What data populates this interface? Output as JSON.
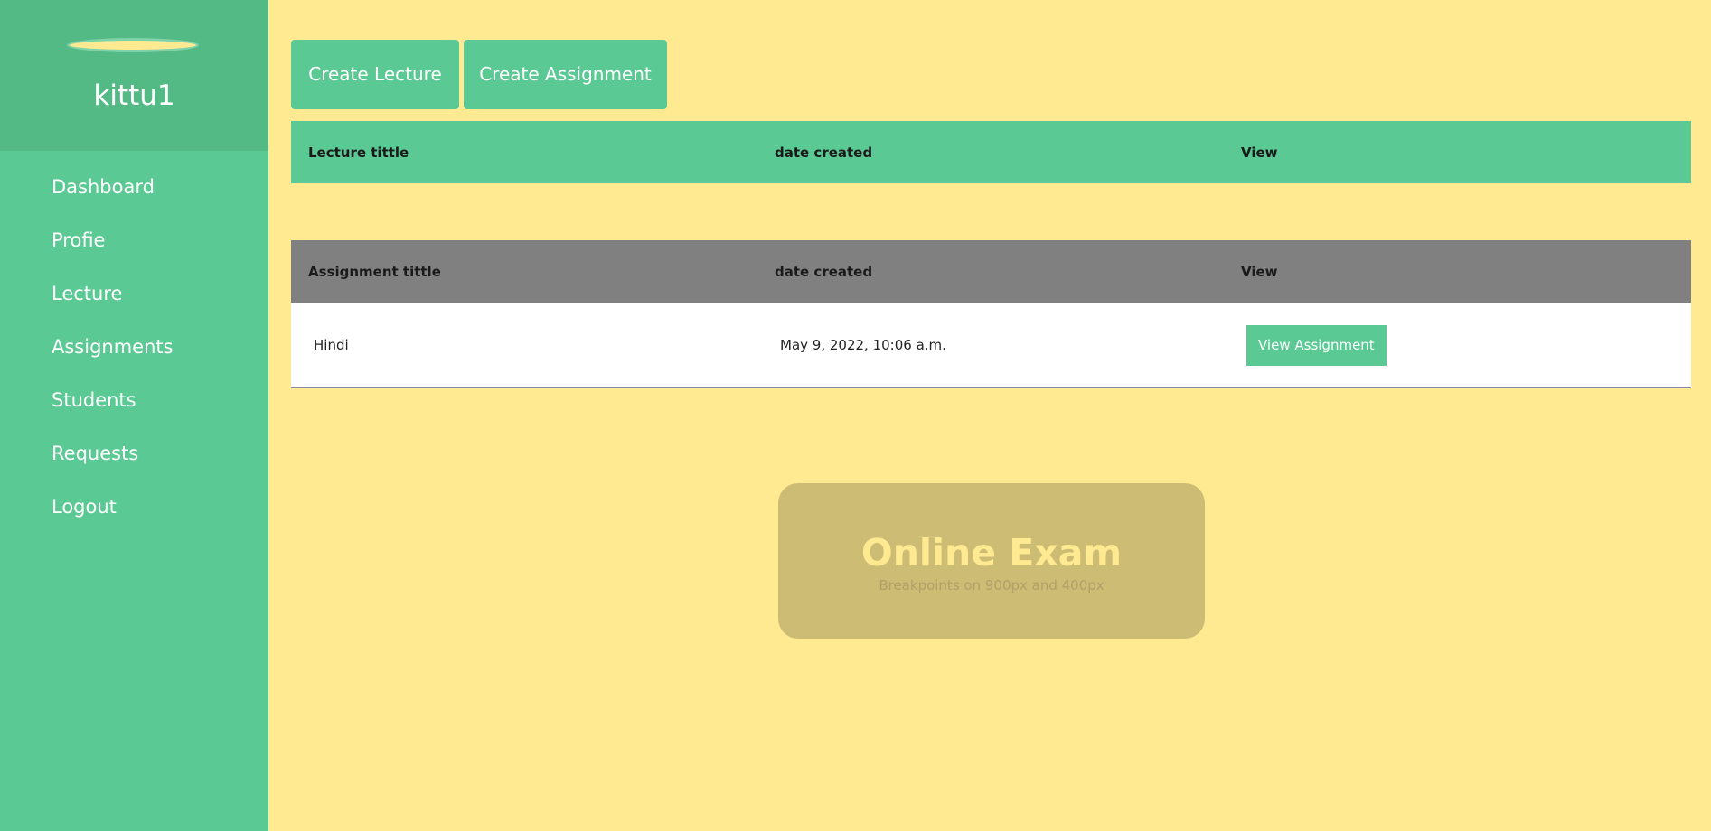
{
  "sidebar": {
    "username": "kittu1",
    "items": [
      {
        "label": "Dashboard"
      },
      {
        "label": "Profie"
      },
      {
        "label": "Lecture"
      },
      {
        "label": "Assignments"
      },
      {
        "label": "Students"
      },
      {
        "label": "Requests"
      },
      {
        "label": "Logout"
      }
    ]
  },
  "actions": {
    "create_lecture": "Create Lecture",
    "create_assignment": "Create Assignment"
  },
  "lecture_table": {
    "headers": [
      "Lecture tittle",
      "date created",
      "View"
    ],
    "rows": []
  },
  "assignment_table": {
    "headers": [
      "Assignment tittle",
      "date created",
      "View"
    ],
    "rows": [
      {
        "title": "Hindi",
        "date": "May 9, 2022, 10:06 a.m.",
        "action": "View Assignment"
      }
    ]
  },
  "watermark": {
    "title": "Online Exam",
    "subtitle": "Breakpoints on 900px and 400px"
  },
  "colors": {
    "background": "#ffe991",
    "sidebar": "#5bc994",
    "sidebar_header": "#53b985",
    "table_header_gray": "#808080",
    "card": "#cdbc74"
  }
}
